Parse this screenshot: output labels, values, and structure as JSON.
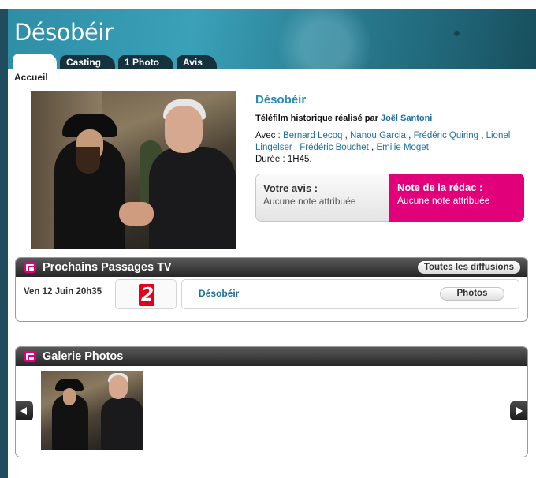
{
  "header": {
    "title": "Désobéir",
    "tabs": [
      "Casting",
      "1 Photo",
      "Avis"
    ]
  },
  "breadcrumb": "Accueil",
  "movie": {
    "title": "Désobéir",
    "subtitle_prefix": "Téléfilm historique réalisé par",
    "director": "Joël Santoni",
    "cast_prefix": "Avec :",
    "cast": [
      "Bernard Lecoq",
      "Nanou Garcia",
      "Frédéric Quiring",
      "Lionel Lingelser",
      "Frédéric Bouchet",
      "Emilie Moget"
    ],
    "duration": "Durée : 1H45."
  },
  "rating": {
    "user_label": "Votre avis :",
    "user_value": "Aucune note attribuée",
    "editor_label": "Note de la rédac :",
    "editor_value": "Aucune note attribuée",
    "editor_color": "#e2007a"
  },
  "tv": {
    "title": "Prochains Passages TV",
    "all_button": "Toutes les diffusions",
    "rows": [
      {
        "date": "Ven 12 Juin 20h35",
        "channel_icon": "france-2-logo",
        "channel_number": "2",
        "program": "Désobéir",
        "photos_button": "Photos"
      }
    ]
  },
  "gallery": {
    "title": "Galerie Photos"
  }
}
